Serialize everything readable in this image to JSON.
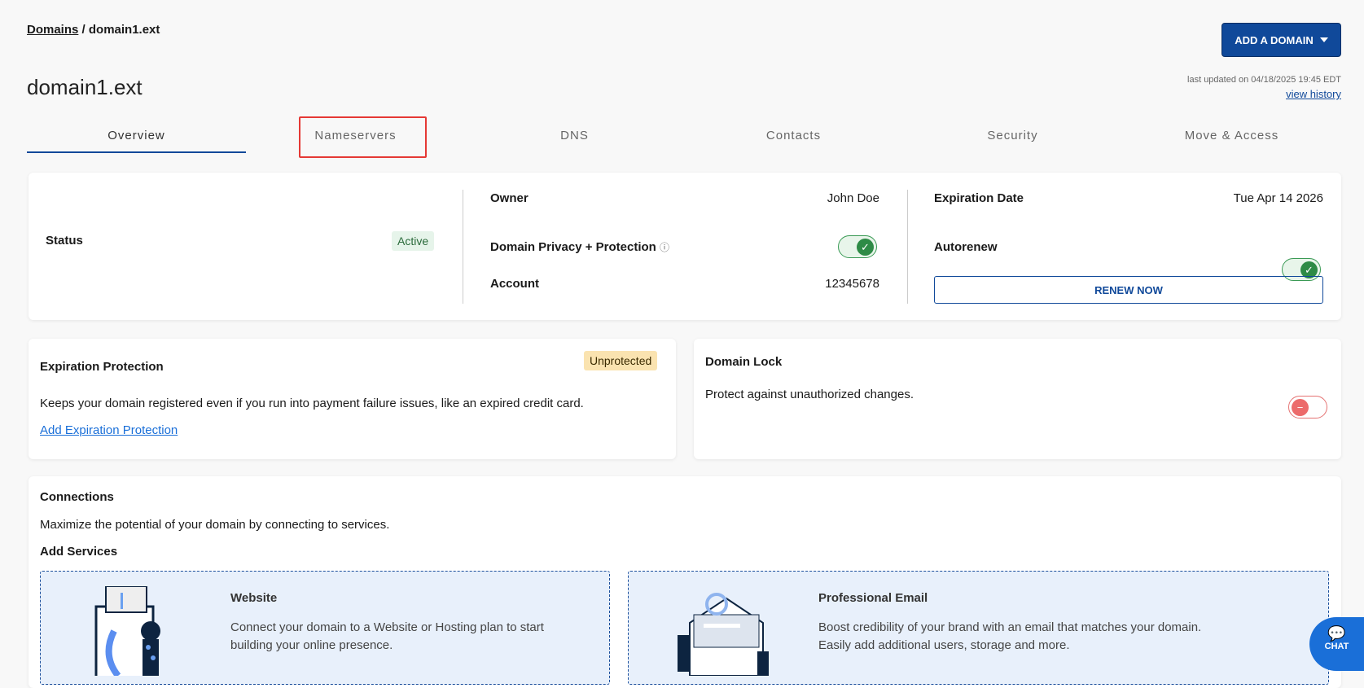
{
  "breadcrumb": {
    "root": "Domains",
    "separator": " / ",
    "current": "domain1.ext"
  },
  "header": {
    "add_domain_label": "ADD A DOMAIN",
    "title": "domain1.ext",
    "last_updated": "last updated on 04/18/2025 19:45 EDT",
    "view_history": "view history"
  },
  "tabs": [
    {
      "label": "Overview"
    },
    {
      "label": "Nameservers"
    },
    {
      "label": "DNS"
    },
    {
      "label": "Contacts"
    },
    {
      "label": "Security"
    },
    {
      "label": "Move & Access"
    }
  ],
  "summary": {
    "status_label": "Status",
    "status_value": "Active",
    "owner_label": "Owner",
    "owner_value": "John Doe",
    "privacy_label": "Domain Privacy + Protection",
    "privacy_on": true,
    "account_label": "Account",
    "account_value": "12345678",
    "expiration_label": "Expiration Date",
    "expiration_value": "Tue Apr 14 2026",
    "autorenew_label": "Autorenew",
    "autorenew_on": true,
    "renew_label": "RENEW NOW"
  },
  "expiration_protection": {
    "title": "Expiration Protection",
    "badge": "Unprotected",
    "description": "Keeps your domain registered even if you run into payment failure issues, like an expired credit card.",
    "link": "Add Expiration Protection"
  },
  "domain_lock": {
    "title": "Domain Lock",
    "description": "Protect against unauthorized changes.",
    "enabled": false
  },
  "connections": {
    "title": "Connections",
    "description": "Maximize the potential of your domain by connecting to services.",
    "add_services": "Add Services",
    "services": [
      {
        "title": "Website",
        "description": "Connect your domain to a Website or Hosting plan to start building your online presence."
      },
      {
        "title": "Professional Email",
        "description": "Boost credibility of your brand with an email that matches your domain. Easily add additional users, storage and more."
      }
    ]
  },
  "chat": {
    "label": "CHAT"
  },
  "colors": {
    "primary": "#10499a",
    "active_bg": "#e6f4ea",
    "unprotected_bg": "#fae3b0",
    "toggle_on": "#2e8b46",
    "toggle_off": "#ec6b6b"
  }
}
